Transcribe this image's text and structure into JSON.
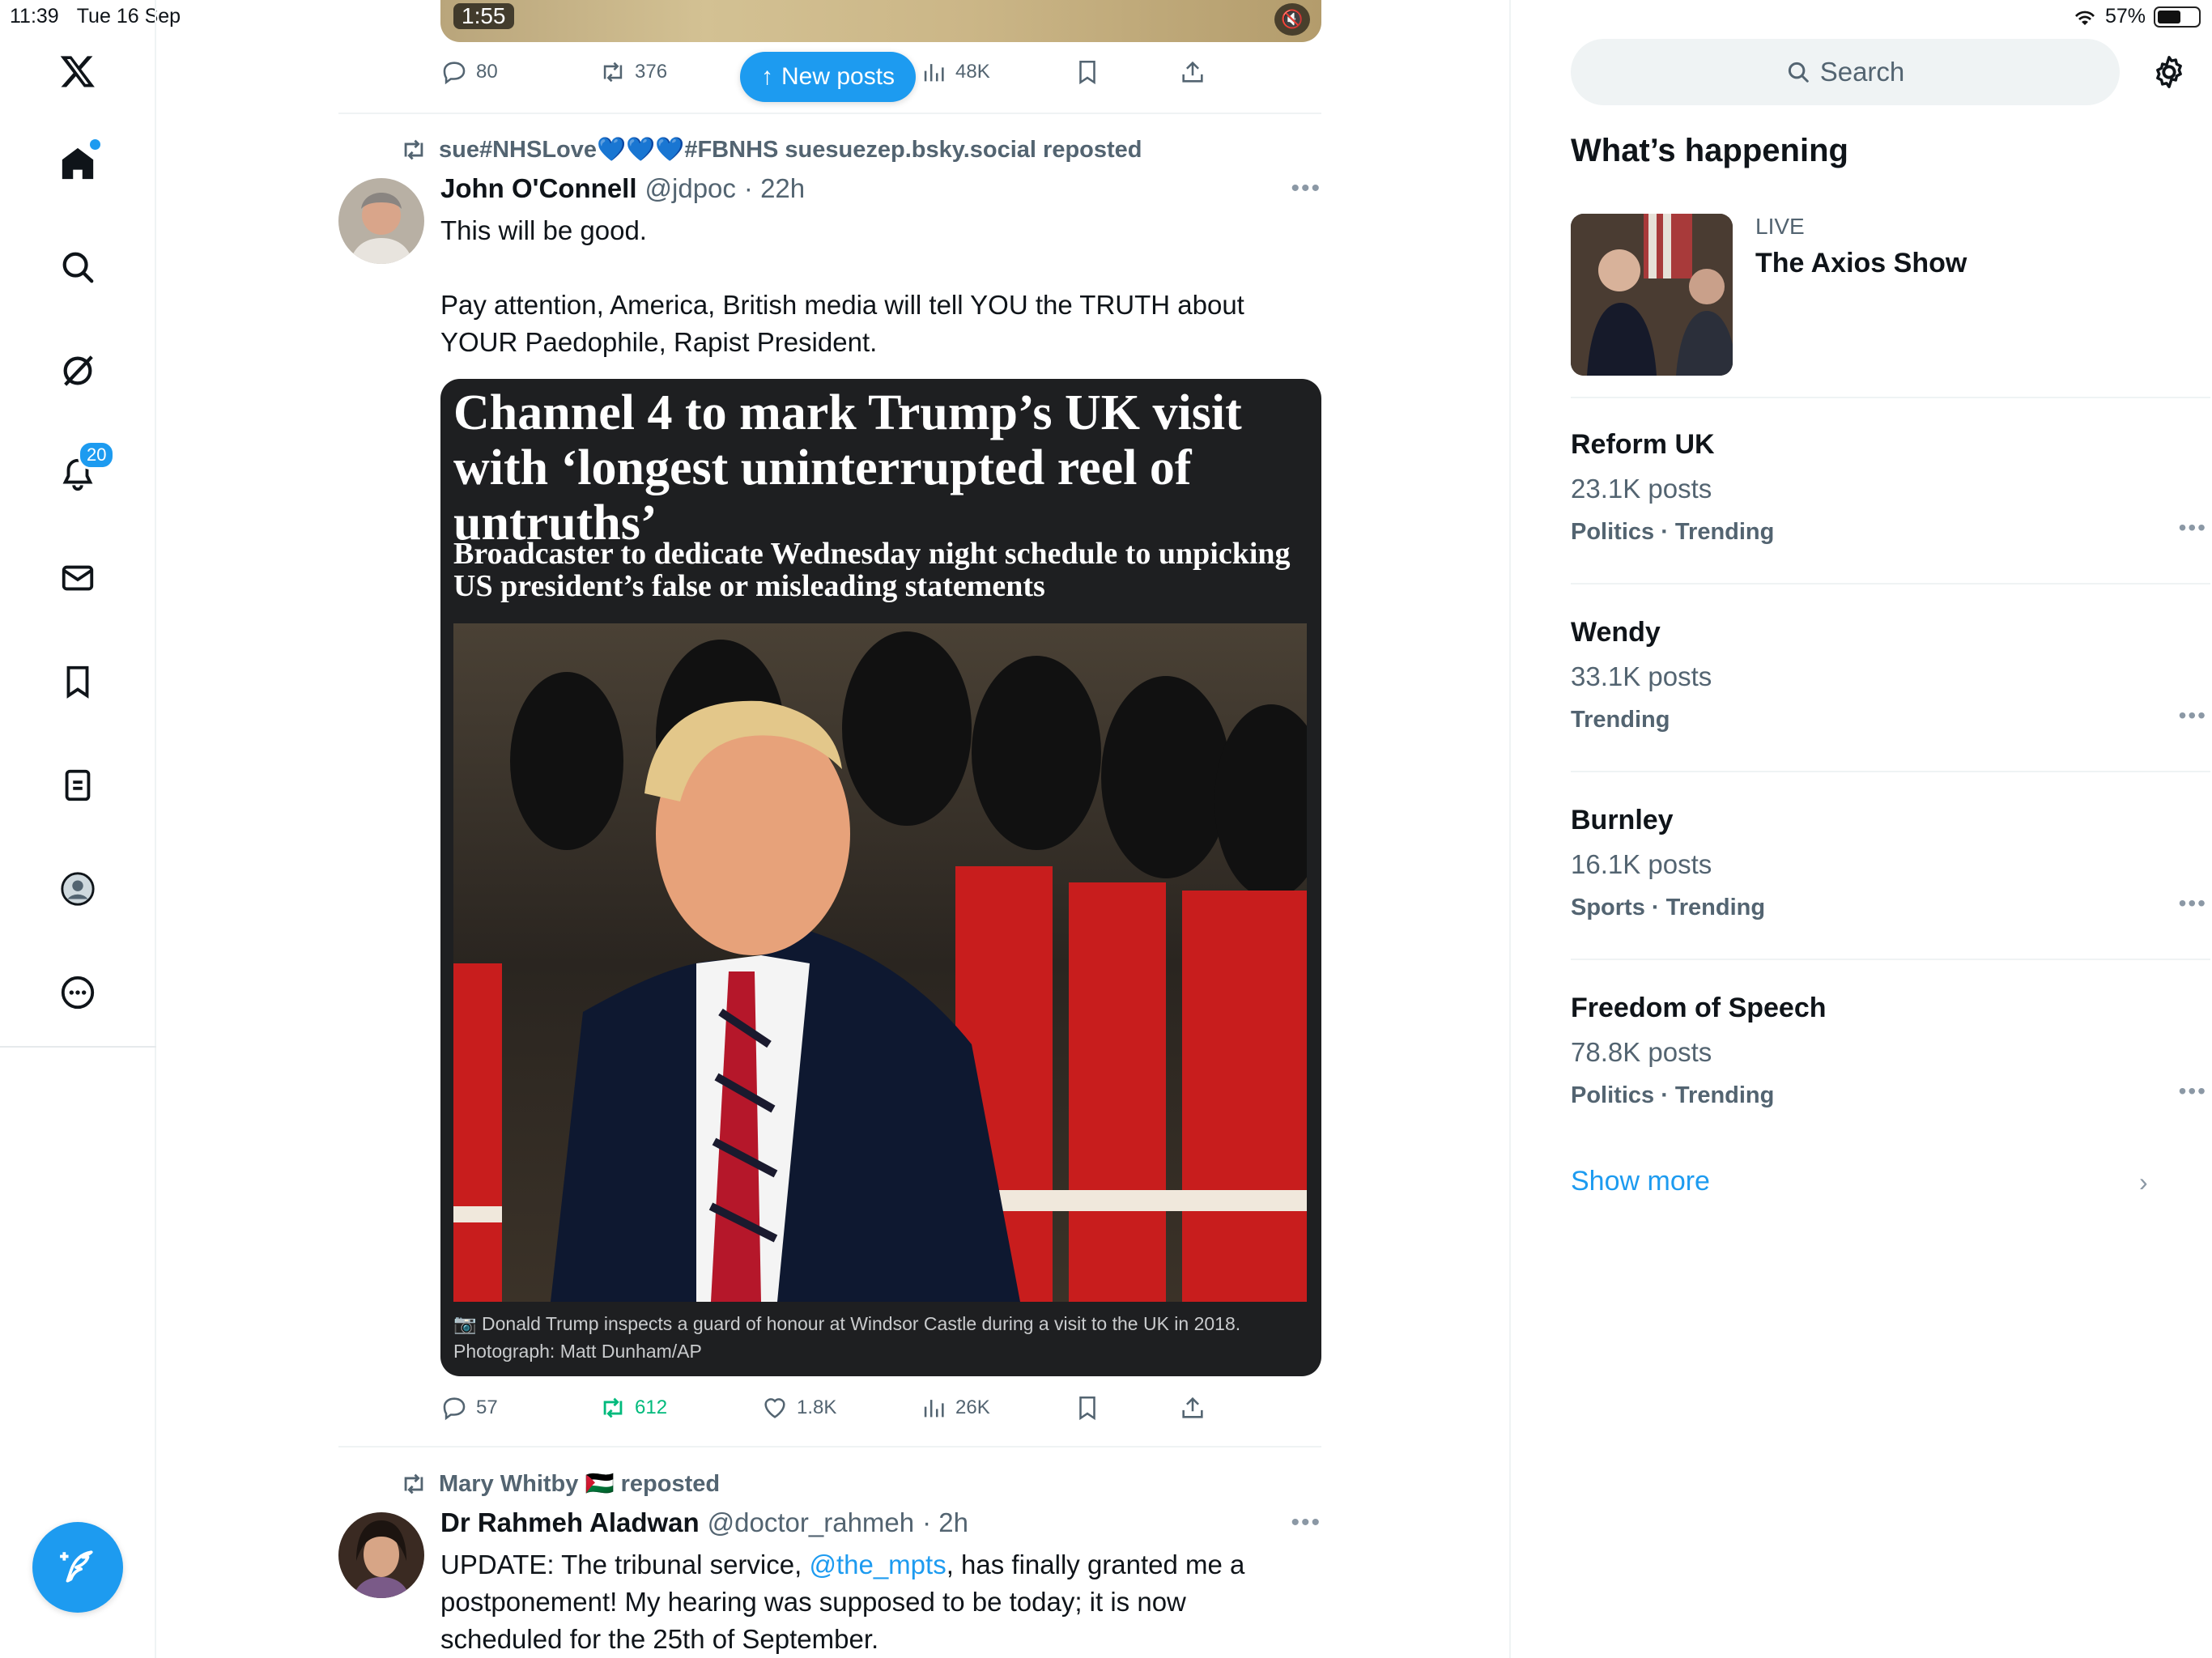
{
  "status": {
    "time": "11:39",
    "date": "Tue 16 Sep",
    "battery": "57%"
  },
  "nav": {
    "notifications_badge": "20"
  },
  "top_post": {
    "video_duration": "1:55",
    "replies": "80",
    "reposts": "376",
    "views": "48K"
  },
  "new_posts_label": "New posts",
  "post1": {
    "repost_by": "sue#NHSLove💙💙💙#FBNHS suesuezep.bsky.social reposted",
    "name": "John O'Connell",
    "handle": "@jdpoc",
    "time": "· 22h",
    "text_line1": "This will be good.",
    "text_line2": "Pay attention, America, British media will tell YOU the TRUTH about YOUR Paedophile, Rapist President.",
    "article": {
      "headline": "Channel 4 to mark Trump’s UK visit with ‘longest uninterrupted reel of untruths’",
      "subheading": "Broadcaster to dedicate Wednesday night schedule to unpicking US president’s false or misleading statements",
      "caption": "Donald Trump inspects a guard of honour at Windsor Castle during a visit to the UK in 2018. Photograph: Matt Dunham/AP"
    },
    "replies": "57",
    "reposts": "612",
    "likes": "1.8K",
    "views": "26K"
  },
  "post2": {
    "repost_by": "Mary Whitby 🇵🇸 reposted",
    "name": "Dr Rahmeh Aladwan",
    "handle": "@doctor_rahmeh",
    "time": "· 2h",
    "text_before": "UPDATE: The tribunal service, ",
    "mention": "@the_mpts",
    "text_after": ", has finally granted me a postponement! My hearing was supposed to be today; it is now scheduled for the 25th of September."
  },
  "sidebar": {
    "search_placeholder": "Search",
    "section_title": "What’s happening",
    "live": {
      "label": "LIVE",
      "title": "The Axios Show"
    },
    "trends": [
      {
        "name": "Reform UK",
        "count": "23.1K posts",
        "category": "Politics · Trending"
      },
      {
        "name": "Wendy",
        "count": "33.1K posts",
        "category": "Trending"
      },
      {
        "name": "Burnley",
        "count": "16.1K posts",
        "category": "Sports · Trending"
      },
      {
        "name": "Freedom of Speech",
        "count": "78.8K posts",
        "category": "Politics · Trending"
      }
    ],
    "show_more": "Show more"
  },
  "colors": {
    "accent": "#1d9bf0",
    "repost_green": "#00ba7c",
    "muted": "#536471"
  }
}
